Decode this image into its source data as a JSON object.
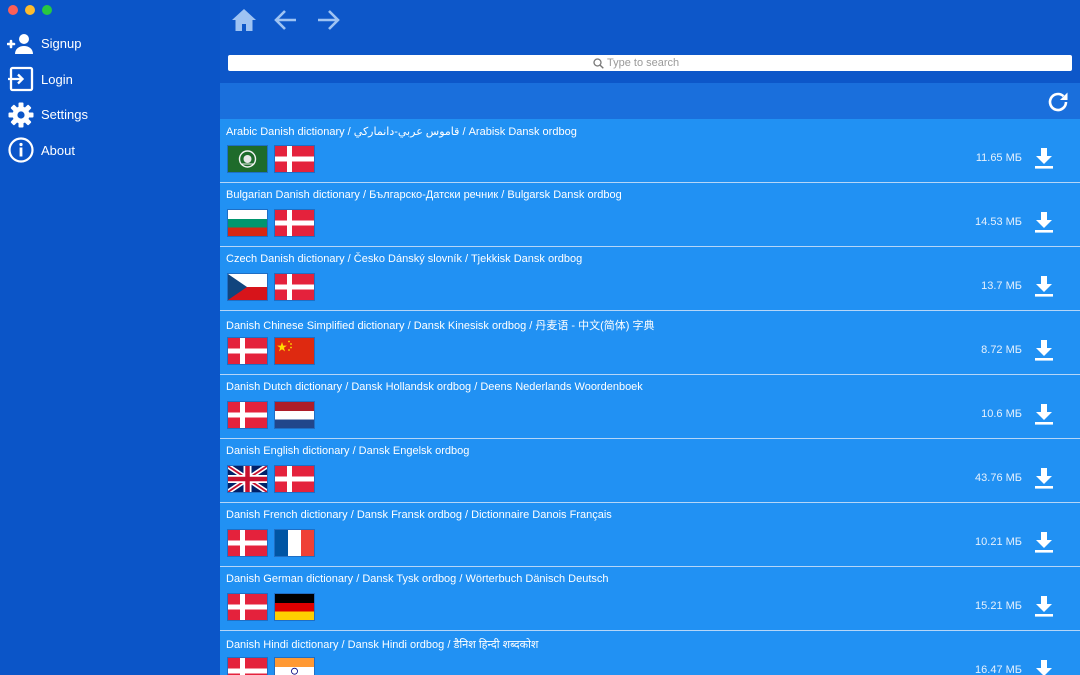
{
  "sidebar": {
    "items": [
      {
        "label": "Signup",
        "icon": "add-user-icon"
      },
      {
        "label": "Login",
        "icon": "login-icon"
      },
      {
        "label": "Settings",
        "icon": "gear-icon"
      },
      {
        "label": "About",
        "icon": "info-icon"
      }
    ]
  },
  "toolbar": {
    "home_icon": "home-icon",
    "back_icon": "arrow-left-icon",
    "forward_icon": "arrow-right-icon"
  },
  "search": {
    "placeholder": "Type to search",
    "value": ""
  },
  "refresh_icon": "refresh-icon",
  "colors": {
    "sidebar_bg": "#0b55c8",
    "list_bg": "#2191f3",
    "subheader_bg": "#1a6fdc",
    "separator": "#b5d6f8"
  },
  "dictionaries": [
    {
      "title": "Arabic Danish dictionary / قاموس عربي-دانماركي / Arabisk Dansk ordbog",
      "size": "11.65 МБ",
      "flags": [
        "arab-league",
        "denmark"
      ]
    },
    {
      "title": "Bulgarian Danish dictionary / Българско-Датски речник / Bulgarsk Dansk ordbog",
      "size": "14.53 МБ",
      "flags": [
        "bulgaria",
        "denmark"
      ]
    },
    {
      "title": "Czech Danish dictionary / Česko Dánský slovník / Tjekkisk Dansk ordbog",
      "size": "13.7 МБ",
      "flags": [
        "czech",
        "denmark"
      ]
    },
    {
      "title": "Danish Chinese Simplified dictionary / Dansk Kinesisk ordbog / 丹麦语 - 中文(简体) 字典",
      "size": "8.72 МБ",
      "flags": [
        "denmark",
        "china"
      ]
    },
    {
      "title": "Danish Dutch dictionary / Dansk Hollandsk ordbog / Deens Nederlands Woordenboek",
      "size": "10.6 МБ",
      "flags": [
        "denmark",
        "netherlands"
      ]
    },
    {
      "title": "Danish English dictionary / Dansk Engelsk ordbog",
      "size": "43.76 МБ",
      "flags": [
        "uk",
        "denmark"
      ]
    },
    {
      "title": "Danish French dictionary / Dansk Fransk ordbog / Dictionnaire Danois Français",
      "size": "10.21 МБ",
      "flags": [
        "denmark",
        "france"
      ]
    },
    {
      "title": "Danish German dictionary / Dansk Tysk ordbog / Wörterbuch Dänisch Deutsch",
      "size": "15.21 МБ",
      "flags": [
        "denmark",
        "germany"
      ]
    },
    {
      "title": "Danish Hindi dictionary / Dansk Hindi ordbog / डैनिश हिन्दी शब्दकोश",
      "size": "16.47 МБ",
      "flags": [
        "denmark",
        "india"
      ]
    }
  ]
}
